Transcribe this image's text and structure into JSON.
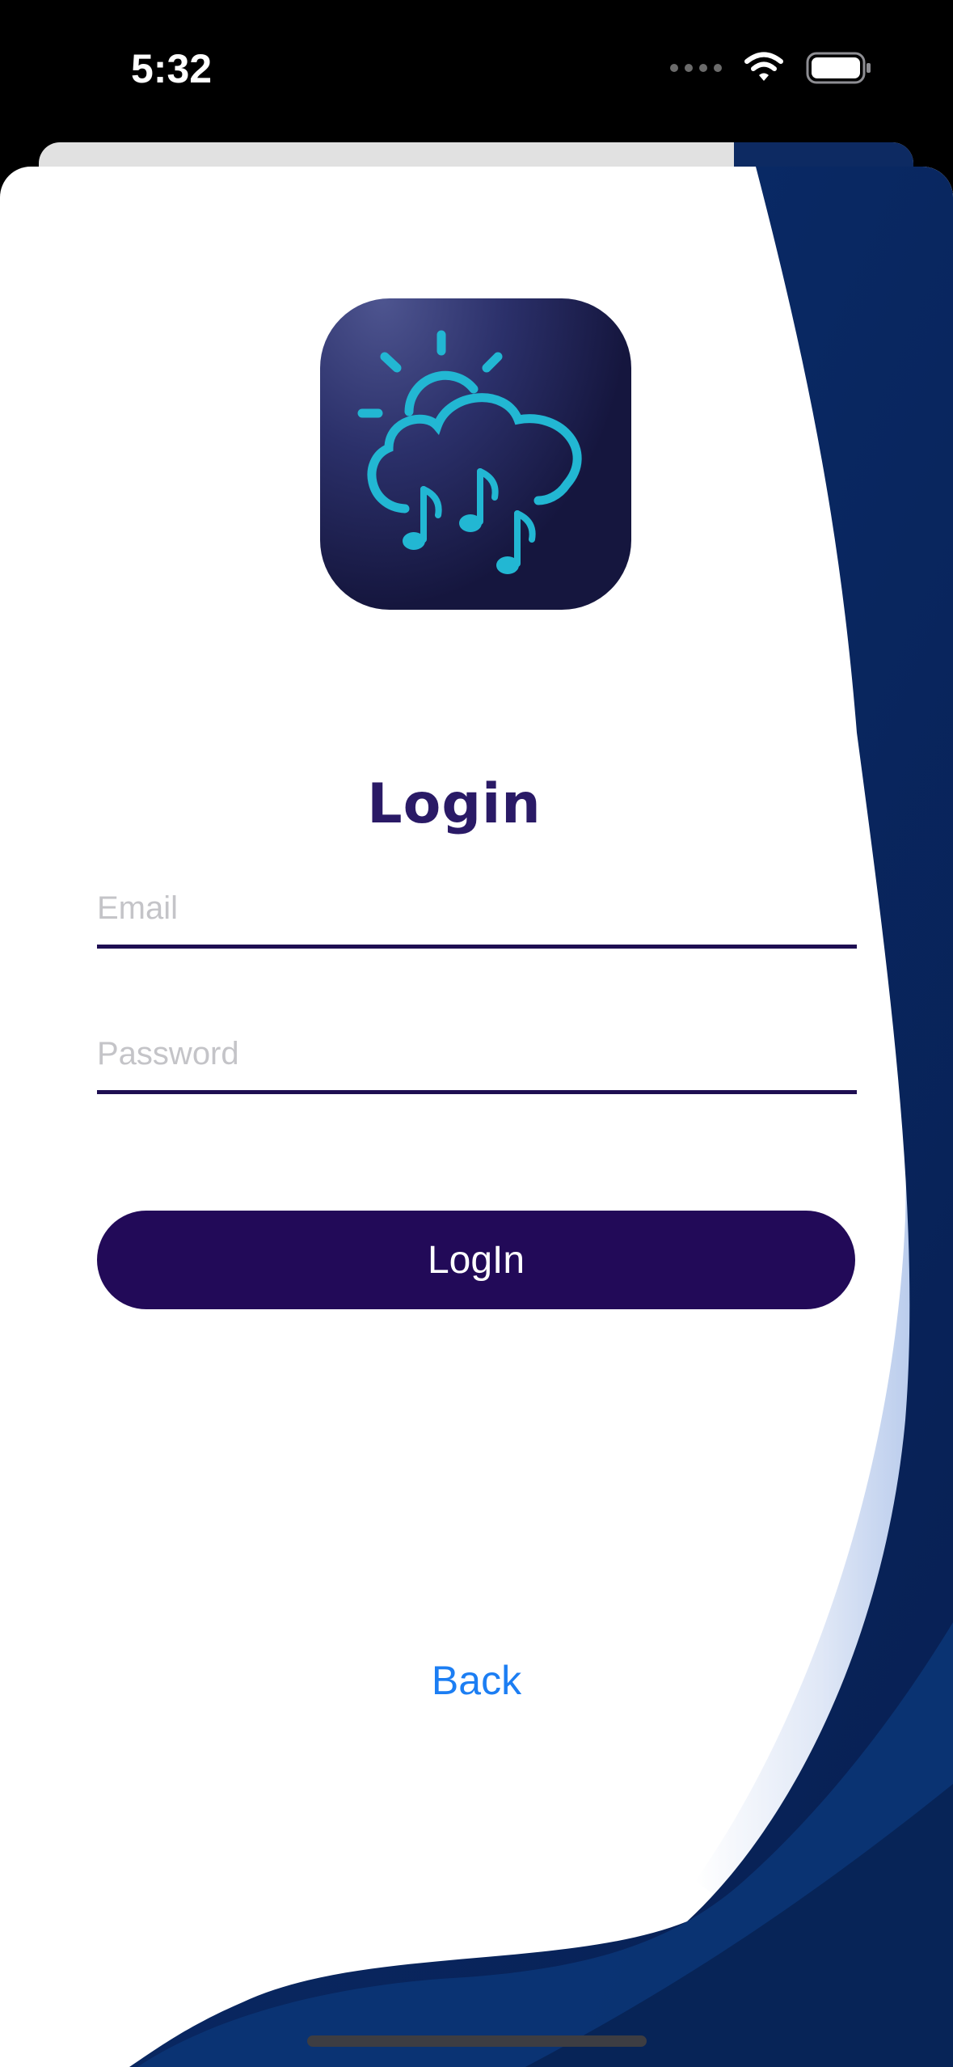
{
  "status_bar": {
    "time": "5:32"
  },
  "login": {
    "title": "Login",
    "email_placeholder": "Email",
    "password_placeholder": "Password",
    "submit_label": "LogIn",
    "back_label": "Back"
  },
  "app_icon": {
    "name": "weather-music-icon"
  },
  "colors": {
    "primary": "#220a58",
    "title": "#2a1a66",
    "link": "#1c7ef3",
    "wave_dark": "#0c2e6e",
    "wave_light": "#c3d3ef",
    "icon_accent": "#22b7d3"
  }
}
